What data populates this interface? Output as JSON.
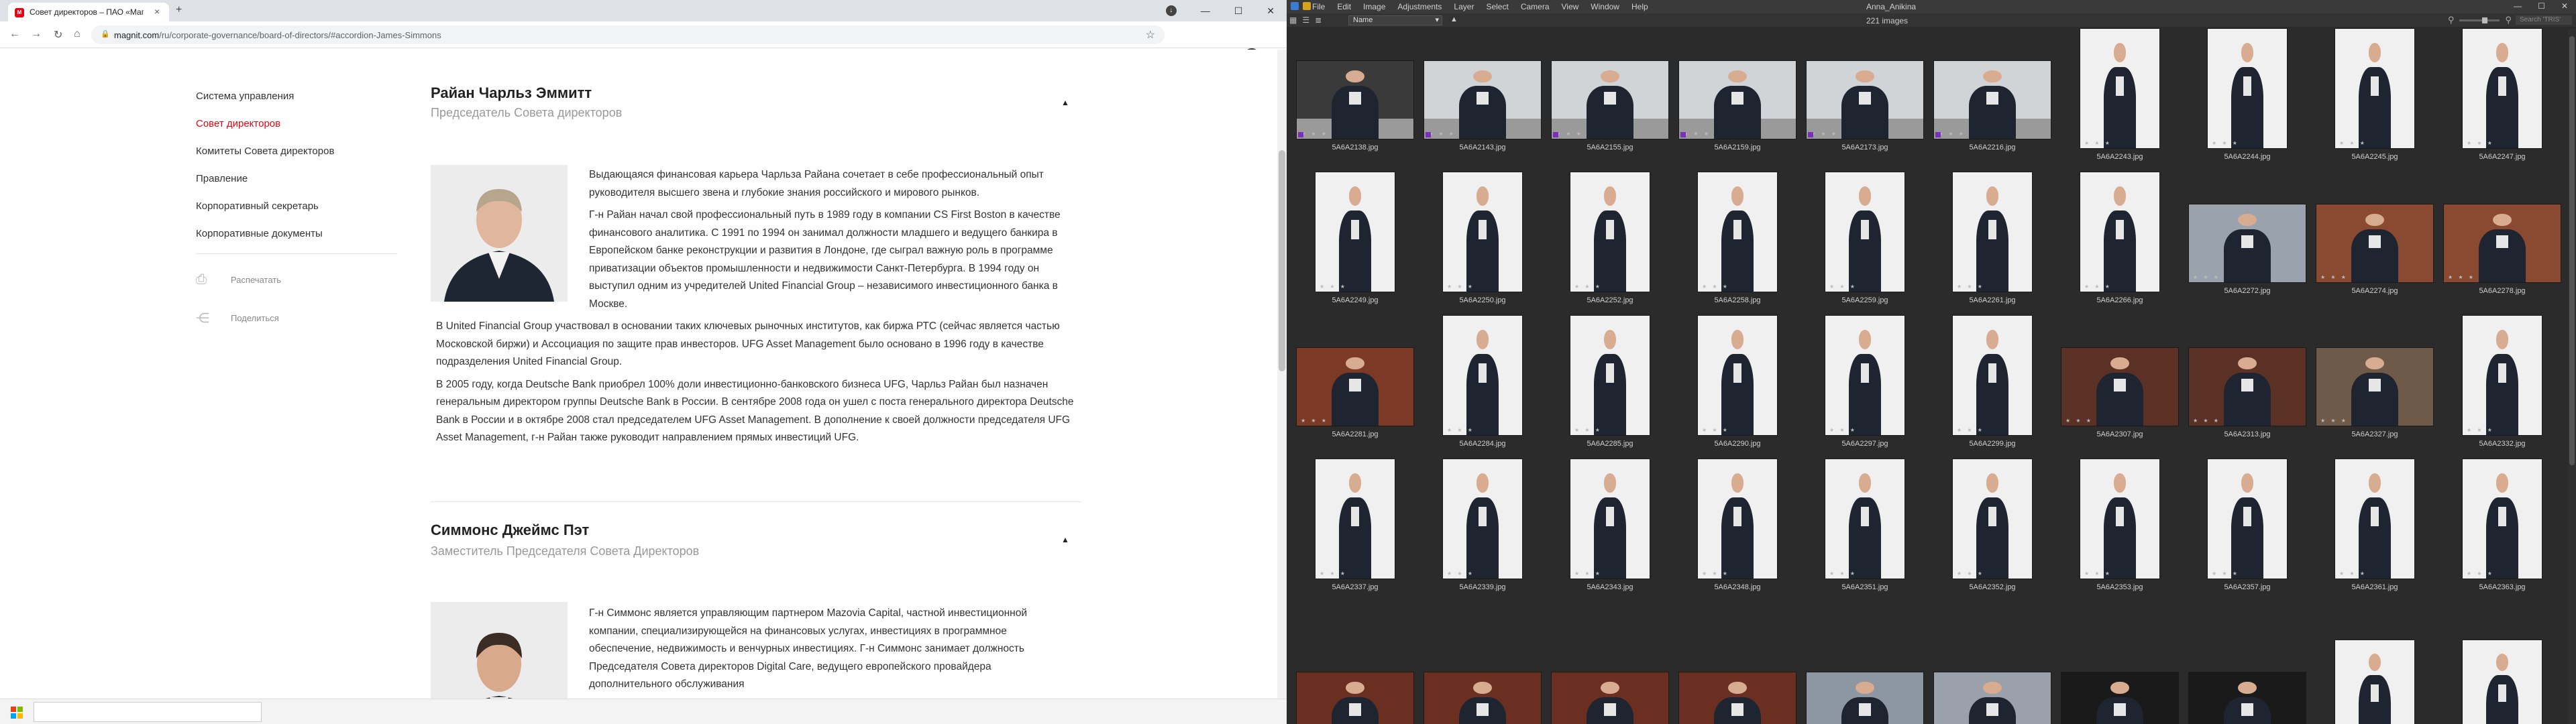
{
  "browser": {
    "tab_title": "Совет директоров – ПАО «Маг»",
    "url_host": "magnit.com",
    "url_path": "/ru/corporate-governance/board-of-directors/#accordion-James-Simmons"
  },
  "site": {
    "sidebar": [
      {
        "label": "Система управления",
        "active": false
      },
      {
        "label": "Совет директоров",
        "active": true
      },
      {
        "label": "Комитеты Совета директоров",
        "active": false
      },
      {
        "label": "Правление",
        "active": false
      },
      {
        "label": "Корпоративный секретарь",
        "active": false
      },
      {
        "label": "Корпоративные документы",
        "active": false
      }
    ],
    "actions": {
      "print": "Распечатать",
      "share": "Поделиться"
    },
    "people": [
      {
        "name": "Райан Чарльз Эммитт",
        "role": "Председатель Совета директоров",
        "paragraphs": [
          "Выдающаяся финансовая карьера Чарльза Райана сочетает в себе профессиональный опыт руководителя высшего звена и глубокие знания российского и мирового рынков.",
          "Г-н Райан начал свой профессиональный путь в 1989 году в компании CS First Boston в качестве финансового аналитика. С 1991 по 1994 он занимал должности младшего и ведущего банкира в Европейском банке реконструкции и развития в Лондоне, где сыграл важную роль в программе приватизации объектов промышленности и недвижимости Санкт-Петербурга. В 1994 году он выступил одним из учредителей United Financial Group – независимого инвестиционного банка в Москве.",
          "В United Financial Group участвовал в основании таких ключевых рыночных институтов, как биржа РТС (сейчас является частью Московской биржи) и Ассоциация по защите прав инвесторов. UFG Asset Management было основано в 1996 году в качестве подразделения United Financial Group.",
          "В 2005 году, когда Deutsche Bank приобрел 100% доли инвестиционно-банковского бизнеса UFG, Чарльз Райан был назначен генеральным директором группы Deutsche Bank в России. В сентябре 2008 года он ушел с поста генерального директора Deutsche Bank в России и в октябре 2008 стал председателем UFG Asset Management. В дополнение к своей должности председателя UFG Asset Management, г-н Райан также руководит направлением прямых инвестиций UFG."
        ]
      },
      {
        "name": "Симмонс Джеймс Пэт",
        "role": "Заместитель Председателя Совета Директоров",
        "paragraphs": [
          "Г-н Симмонс является управляющим партнером Mazovia Capital, частной инвестиционной компании, специализирующейся на финансовых услугах, инвестициях в программное обеспечение, недвижимость и венчурных инвестициях. Г-н Симмонс занимает должность Председателя Совета директоров Digital Care, ведущего европейского провайдера дополнительного обслуживания"
        ]
      }
    ]
  },
  "bridge": {
    "menu": [
      "File",
      "Edit",
      "Image",
      "Adjustments",
      "Layer",
      "Select",
      "Camera",
      "View",
      "Window",
      "Help"
    ],
    "window_title": "Anna_Anikina",
    "sort_label": "Name",
    "image_count": "221 images",
    "search_placeholder": "Search 'TRIS'",
    "accent_label_color": "#7b2dbd",
    "thumbnails": [
      [
        "5A6A2138.jpg",
        "5A6A2143.jpg",
        "5A6A2155.jpg",
        "5A6A2159.jpg",
        "5A6A2173.jpg",
        "5A6A2216.jpg",
        "5A6A2243.jpg",
        "5A6A2244.jpg",
        "5A6A2245.jpg",
        "5A6A2247.jpg"
      ],
      [
        "5A6A2249.jpg",
        "5A6A2250.jpg",
        "5A6A2252.jpg",
        "5A6A2258.jpg",
        "5A6A2259.jpg",
        "5A6A2261.jpg",
        "5A6A2266.jpg",
        "5A6A2272.jpg",
        "5A6A2274.jpg",
        "5A6A2278.jpg"
      ],
      [
        "5A6A2281.jpg",
        "5A6A2284.jpg",
        "5A6A2285.jpg",
        "5A6A2290.jpg",
        "5A6A2297.jpg",
        "5A6A2299.jpg",
        "5A6A2307.jpg",
        "5A6A2313.jpg",
        "5A6A2327.jpg",
        "5A6A2332.jpg"
      ],
      [
        "5A6A2337.jpg",
        "5A6A2339.jpg",
        "5A6A2343.jpg",
        "5A6A2348.jpg",
        "5A6A2351.jpg",
        "5A6A2352.jpg",
        "5A6A2353.jpg",
        "5A6A2357.jpg",
        "5A6A2361.jpg",
        "5A6A2363.jpg"
      ],
      [
        "",
        "",
        "",
        "",
        "",
        "",
        "",
        "",
        "",
        ""
      ]
    ]
  }
}
